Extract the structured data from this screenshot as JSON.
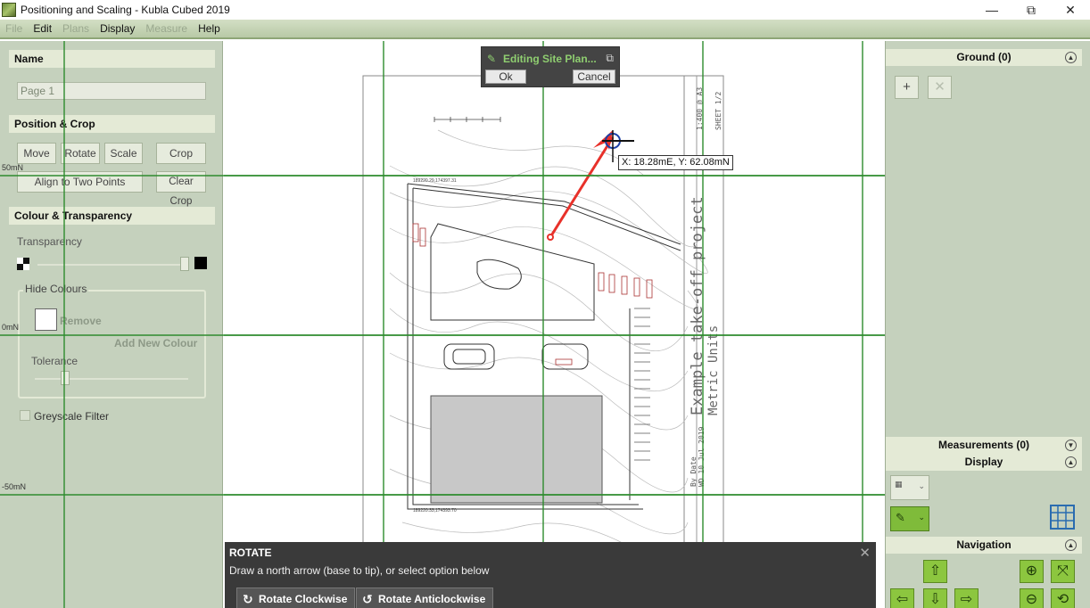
{
  "window": {
    "title": "Positioning and Scaling - Kubla Cubed 2019",
    "minimize": "—",
    "maximize": "⧉",
    "close": "✕"
  },
  "menu": [
    {
      "label": "File",
      "enabled": false
    },
    {
      "label": "Edit",
      "enabled": true
    },
    {
      "label": "Plans",
      "enabled": false
    },
    {
      "label": "Display",
      "enabled": true
    },
    {
      "label": "Measure",
      "enabled": false
    },
    {
      "label": "Help",
      "enabled": true
    }
  ],
  "left": {
    "name_header": "Name",
    "name_value": "Page 1",
    "position_header": "Position & Crop",
    "move": "Move",
    "rotate": "Rotate",
    "scale": "Scale",
    "crop": "Crop",
    "align": "Align to Two Points",
    "clear_crop": "Clear Crop",
    "colour_header": "Colour & Transparency",
    "transparency": "Transparency",
    "hide_colours": "Hide Colours",
    "remove": "Remove",
    "add_new_colour": "Add New Colour",
    "tolerance": "Tolerance",
    "greyscale": "Greyscale Filter"
  },
  "axis": {
    "y_top": "50mN",
    "y_mid": "0mN",
    "y_bottom": "-50mN"
  },
  "editing": {
    "title": "Editing Site Plan...",
    "ok": "Ok",
    "cancel": "Cancel"
  },
  "coordinate_readout": "X: 18.28mE, Y: 62.08mN",
  "rotate": {
    "title": "ROTATE",
    "description": "Draw a north arrow (base to tip), or select option below",
    "clockwise": "Rotate Clockwise",
    "anticlockwise": "Rotate Anticlockwise"
  },
  "right": {
    "ground": "Ground (0)",
    "measurements": "Measurements (0)",
    "display": "Display",
    "navigation": "Navigation",
    "add_icon": "+",
    "delete_icon": "✕"
  },
  "plan": {
    "sheet_label": "SHEET 1/2",
    "scale_label": "1:400 @ A3",
    "project_text": "Example take-off project",
    "units_text": "Metric Units",
    "date_label": "By  Date",
    "date_value": "WD 10 Jul 2019",
    "coord_top": "189220.29,174397.31",
    "coord_bottom": "189220.33,174393.70"
  },
  "colors": {
    "panel_bg": "#c5d1bd",
    "header_bg": "#e4ead6",
    "accent_green": "#8cc63f",
    "grid_line": "#2e8b2e",
    "arrow_red": "#e8312a",
    "edit_title_green": "#8fce70"
  }
}
